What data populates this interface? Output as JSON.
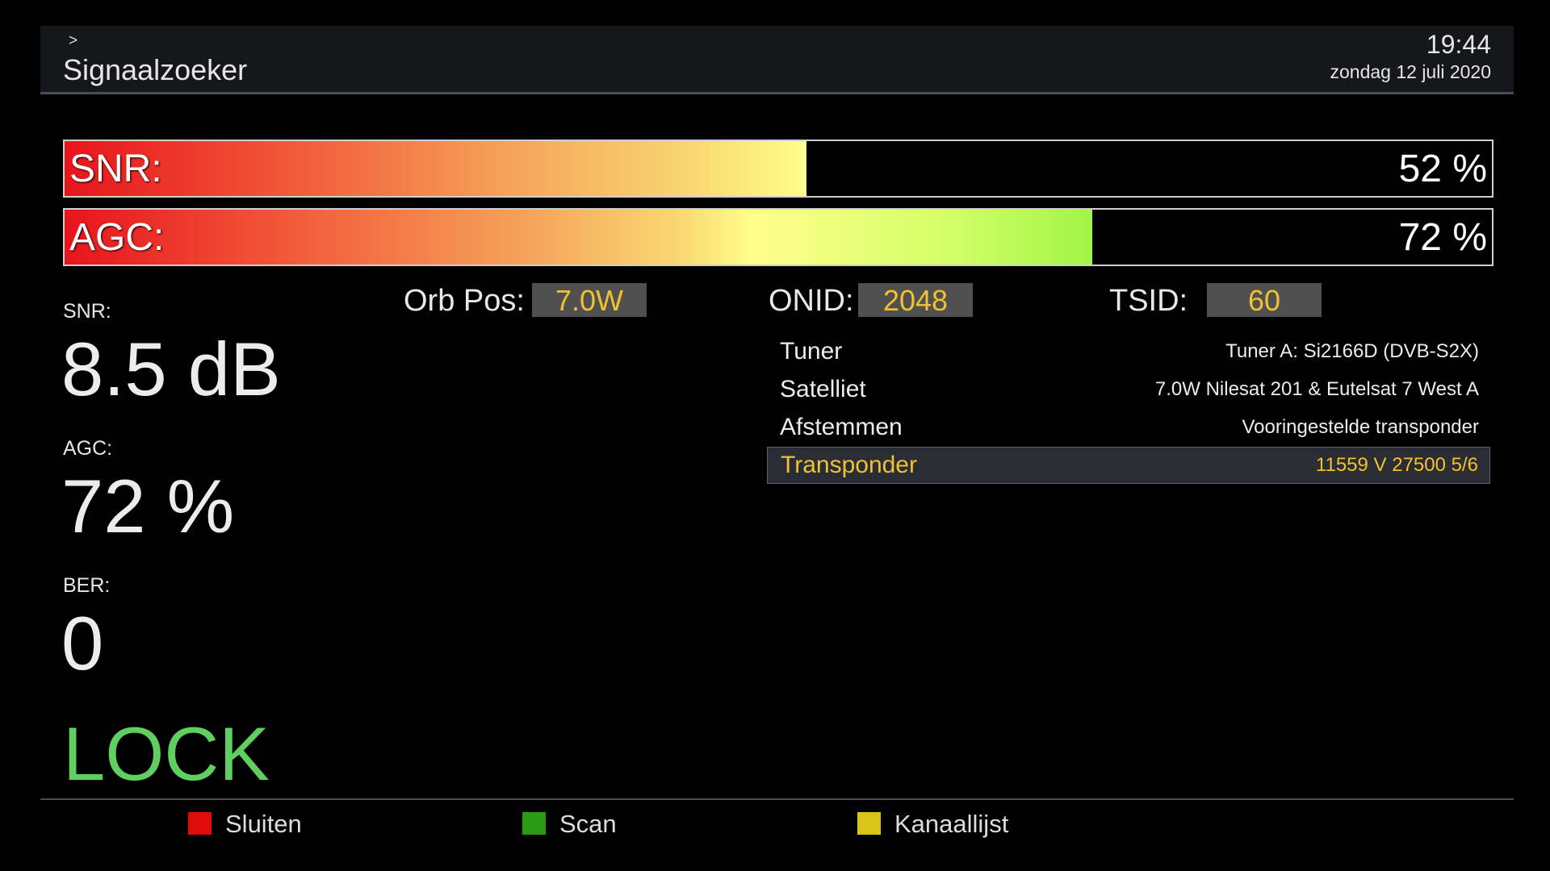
{
  "header": {
    "breadcrumb": ">",
    "title": "Signaalzoeker",
    "time": "19:44",
    "date": "zondag 12 juli 2020"
  },
  "bars": {
    "snr": {
      "label": "SNR:",
      "value": "52 %",
      "percent": 52
    },
    "agc": {
      "label": "AGC:",
      "value": "72 %",
      "percent": 72
    }
  },
  "metrics": {
    "snr": {
      "label": "SNR:",
      "value": "8.5 dB"
    },
    "agc": {
      "label": "AGC:",
      "value": "72 %"
    },
    "ber": {
      "label": "BER:",
      "value": "0"
    },
    "lock": "LOCK"
  },
  "fields": {
    "orbpos": {
      "label": "Orb Pos:",
      "value": "7.0W"
    },
    "onid": {
      "label": "ONID:",
      "value": "2048"
    },
    "tsid": {
      "label": "TSID:",
      "value": "60"
    }
  },
  "table": [
    {
      "key": "Tuner",
      "value": "Tuner A: Si2166D (DVB-S2X)",
      "selected": false
    },
    {
      "key": "Satelliet",
      "value": "7.0W Nilesat 201 & Eutelsat 7 West A",
      "selected": false
    },
    {
      "key": "Afstemmen",
      "value": "Vooringestelde transponder",
      "selected": false
    },
    {
      "key": "Transponder",
      "value": "11559 V 27500 5/6",
      "selected": true
    }
  ],
  "footer": {
    "red": {
      "label": "Sluiten",
      "color": "#e00c0c"
    },
    "green": {
      "label": "Scan",
      "color": "#2a9a14"
    },
    "yellow": {
      "label": "Kanaallijst",
      "color": "#d9c51a"
    }
  },
  "colors": {
    "highlight_text": "#f0c130",
    "lock_green": "#5fcf5f"
  }
}
